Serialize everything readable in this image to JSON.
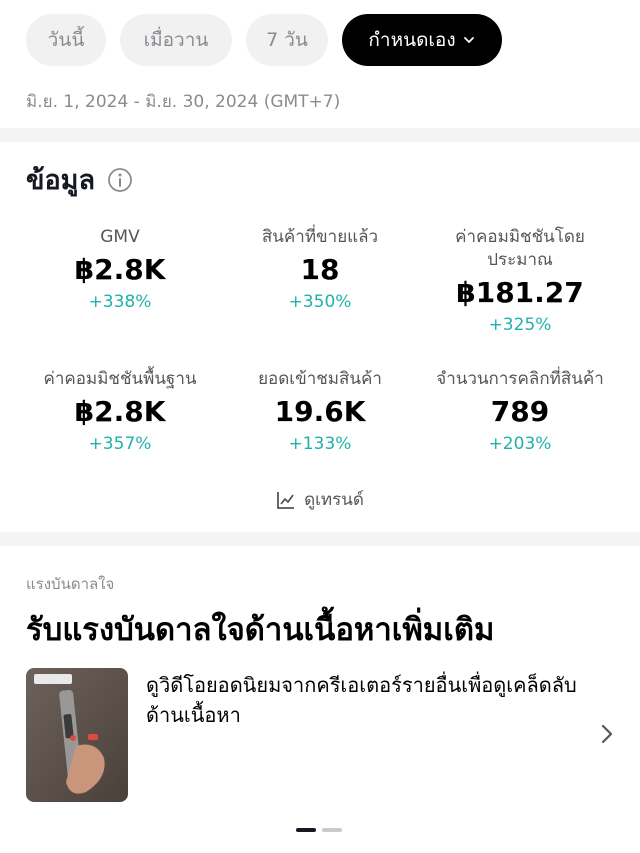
{
  "filters": {
    "chips": [
      "วันนี้",
      "เมื่อวาน",
      "7 วัน"
    ],
    "active": "กำหนดเอง",
    "date_range": "มิ.ย. 1, 2024 - มิ.ย. 30, 2024 (GMT+7)"
  },
  "info": {
    "title": "ข้อมูล",
    "metrics": [
      {
        "label": "GMV",
        "value": "฿2.8K",
        "change": "+338%"
      },
      {
        "label": "สินค้าที่ขายแล้ว",
        "value": "18",
        "change": "+350%"
      },
      {
        "label": "ค่าคอมมิชชันโดยประมาณ",
        "value": "฿181.27",
        "change": "+325%"
      },
      {
        "label": "ค่าคอมมิชชันพื้นฐาน",
        "value": "฿2.8K",
        "change": "+357%"
      },
      {
        "label": "ยอดเข้าชมสินค้า",
        "value": "19.6K",
        "change": "+133%"
      },
      {
        "label": "จำนวนการคลิกที่สินค้า",
        "value": "789",
        "change": "+203%"
      }
    ],
    "trend_link": "ดูเทรนด์"
  },
  "inspiration": {
    "subtitle": "แรงบันดาลใจ",
    "heading": "รับแรงบันดาลใจด้านเนื้อหาเพิ่มเติม",
    "description": "ดูวิดีโอยอดนิยมจากครีเอเตอร์รายอื่นเพื่อดูเคล็ดลับด้านเนื้อหา"
  },
  "colors": {
    "accent": "#20b2aa",
    "active_chip": "#000000"
  }
}
